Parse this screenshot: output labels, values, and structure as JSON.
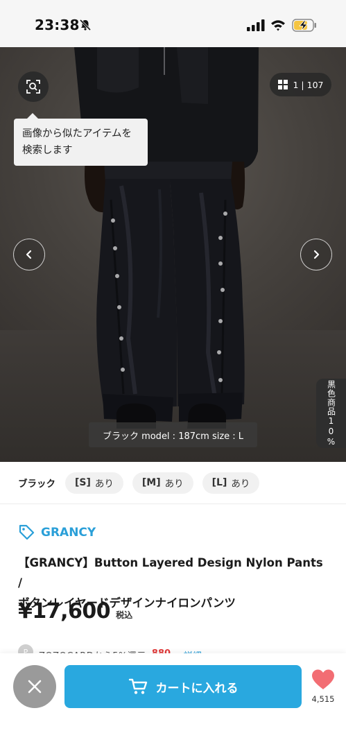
{
  "status_bar": {
    "time": "23:38",
    "icons": [
      "bell-slash-icon",
      "signal-icon",
      "wifi-icon",
      "battery-charging-icon"
    ],
    "battery_color": "#f5c542"
  },
  "gallery": {
    "image_search_tooltip": "画像から似たアイテムを検索します",
    "counter": "1 | 107",
    "caption": "ブラック model : 187cm size : L",
    "side_tag": "黒色商品10%",
    "icons": [
      "image-search-icon",
      "grid-icon",
      "chevron-left-icon",
      "chevron-right-icon"
    ]
  },
  "sizes": {
    "color_label": "ブラック",
    "items": [
      {
        "size": "[S]",
        "stock": "あり"
      },
      {
        "size": "[M]",
        "stock": "あり"
      },
      {
        "size": "[L]",
        "stock": "あり"
      }
    ]
  },
  "product": {
    "brand": "GRANCY",
    "title_line1": "【GRANCY】Button Layered Design Nylon Pants /",
    "title_line2": "ボタンレイヤードデザインナイロンパンツ",
    "price": "¥17,600",
    "tax_label": "税込",
    "promo_icon_text": "P",
    "promo_text": "ZOZOCARDから5%還元",
    "promo_amount": "880",
    "promo_link": "▸ 詳細",
    "brand_color": "#2a9fd8"
  },
  "bottom_bar": {
    "cart_label": "カートに入れる",
    "favorite_count": "4,515",
    "cart_color": "#29a8df",
    "heart_color": "#f26d73",
    "icons": [
      "close-icon",
      "cart-icon",
      "heart-icon"
    ]
  }
}
